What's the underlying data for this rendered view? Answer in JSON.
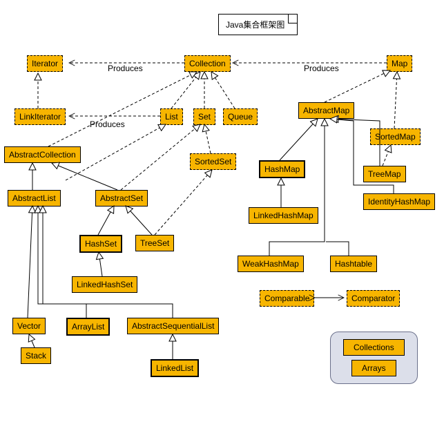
{
  "title": "Java集合框架图",
  "legend": {
    "items": [
      "Collections",
      "Arrays"
    ]
  },
  "edge_labels": {
    "p1": "Produces",
    "p2": "Produces",
    "p3": "Produces"
  },
  "nodes": {
    "iterator": "Iterator",
    "collection": "Collection",
    "map": "Map",
    "linkIterator": "LinkIterator",
    "list": "List",
    "set": "Set",
    "queue": "Queue",
    "abstractMap": "AbstractMap",
    "sortedMap": "SortedMap",
    "abstractCollection": "AbstractCollection",
    "sortedSet": "SortedSet",
    "hashMap": "HashMap",
    "treeMap": "TreeMap",
    "identityHashMap": "IdentityHashMap",
    "abstractList": "AbstractList",
    "abstractSet": "AbstractSet",
    "linkedHashMap": "LinkedHashMap",
    "hashSet": "HashSet",
    "treeSet": "TreeSet",
    "weakHashMap": "WeakHashMap",
    "hashtable": "Hashtable",
    "linkedHashSet": "LinkedHashSet",
    "comparable": "Comparable",
    "comparator": "Comparator",
    "vector": "Vector",
    "arrayList": "ArrayList",
    "abstractSequentialList": "AbstractSequentialList",
    "stack": "Stack",
    "linkedList": "LinkedList"
  },
  "chart_data": {
    "type": "diagram",
    "title": "Java集合框架图",
    "notation": "UML class diagram (interfaces shown with dashed borders, classes with solid borders, highlighted concrete classes with bold borders)",
    "interfaces": [
      "Iterator",
      "LinkIterator",
      "Collection",
      "List",
      "Set",
      "Queue",
      "SortedSet",
      "Map",
      "SortedMap",
      "Comparable",
      "Comparator"
    ],
    "abstract_classes": [
      "AbstractCollection",
      "AbstractList",
      "AbstractSet",
      "AbstractSequentialList",
      "AbstractMap"
    ],
    "concrete_classes": [
      "HashSet",
      "LinkedHashSet",
      "TreeSet",
      "Vector",
      "Stack",
      "ArrayList",
      "LinkedList",
      "HashMap",
      "LinkedHashMap",
      "TreeMap",
      "IdentityHashMap",
      "WeakHashMap",
      "Hashtable"
    ],
    "highlighted_classes": [
      "HashSet",
      "ArrayList",
      "LinkedList",
      "HashMap"
    ],
    "utility_classes": [
      "Collections",
      "Arrays"
    ],
    "edges": [
      {
        "from": "LinkIterator",
        "to": "Iterator",
        "type": "extends",
        "style": "dashed",
        "head": "hollow-triangle"
      },
      {
        "from": "List",
        "to": "Collection",
        "type": "extends",
        "style": "dashed",
        "head": "hollow-triangle"
      },
      {
        "from": "Set",
        "to": "Collection",
        "type": "extends",
        "style": "dashed",
        "head": "hollow-triangle"
      },
      {
        "from": "Queue",
        "to": "Collection",
        "type": "extends",
        "style": "dashed",
        "head": "hollow-triangle"
      },
      {
        "from": "SortedSet",
        "to": "Set",
        "type": "extends",
        "style": "dashed",
        "head": "hollow-triangle"
      },
      {
        "from": "SortedMap",
        "to": "Map",
        "type": "extends",
        "style": "dashed",
        "head": "hollow-triangle"
      },
      {
        "from": "AbstractCollection",
        "to": "Collection",
        "type": "implements",
        "style": "dashed",
        "head": "hollow-triangle"
      },
      {
        "from": "AbstractList",
        "to": "AbstractCollection",
        "type": "extends",
        "style": "solid",
        "head": "hollow-triangle"
      },
      {
        "from": "AbstractList",
        "to": "List",
        "type": "implements",
        "style": "dashed",
        "head": "hollow-triangle"
      },
      {
        "from": "AbstractSet",
        "to": "AbstractCollection",
        "type": "extends",
        "style": "solid",
        "head": "hollow-triangle"
      },
      {
        "from": "AbstractSet",
        "to": "Set",
        "type": "implements",
        "style": "dashed",
        "head": "hollow-triangle"
      },
      {
        "from": "TreeSet",
        "to": "SortedSet",
        "type": "implements",
        "style": "dashed",
        "head": "hollow-triangle"
      },
      {
        "from": "HashSet",
        "to": "AbstractSet",
        "type": "extends",
        "style": "solid",
        "head": "hollow-triangle"
      },
      {
        "from": "TreeSet",
        "to": "AbstractSet",
        "type": "extends",
        "style": "solid",
        "head": "hollow-triangle"
      },
      {
        "from": "LinkedHashSet",
        "to": "HashSet",
        "type": "extends",
        "style": "solid",
        "head": "hollow-triangle"
      },
      {
        "from": "Vector",
        "to": "AbstractList",
        "type": "extends",
        "style": "solid",
        "head": "hollow-triangle"
      },
      {
        "from": "ArrayList",
        "to": "AbstractList",
        "type": "extends",
        "style": "solid",
        "head": "hollow-triangle"
      },
      {
        "from": "AbstractSequentialList",
        "to": "AbstractList",
        "type": "extends",
        "style": "solid",
        "head": "hollow-triangle"
      },
      {
        "from": "Stack",
        "to": "Vector",
        "type": "extends",
        "style": "solid",
        "head": "hollow-triangle"
      },
      {
        "from": "LinkedList",
        "to": "AbstractSequentialList",
        "type": "extends",
        "style": "solid",
        "head": "hollow-triangle"
      },
      {
        "from": "AbstractMap",
        "to": "Map",
        "type": "implements",
        "style": "dashed",
        "head": "hollow-triangle"
      },
      {
        "from": "HashMap",
        "to": "AbstractMap",
        "type": "extends",
        "style": "solid",
        "head": "hollow-triangle"
      },
      {
        "from": "TreeMap",
        "to": "AbstractMap",
        "type": "extends",
        "style": "solid",
        "head": "hollow-triangle"
      },
      {
        "from": "TreeMap",
        "to": "SortedMap",
        "type": "implements",
        "style": "dashed",
        "head": "hollow-triangle"
      },
      {
        "from": "IdentityHashMap",
        "to": "AbstractMap",
        "type": "extends",
        "style": "solid",
        "head": "hollow-triangle"
      },
      {
        "from": "WeakHashMap",
        "to": "AbstractMap",
        "type": "extends",
        "style": "solid",
        "head": "hollow-triangle"
      },
      {
        "from": "Hashtable",
        "to": "AbstractMap",
        "type": "extends",
        "style": "solid",
        "head": "hollow-triangle"
      },
      {
        "from": "LinkedHashMap",
        "to": "HashMap",
        "type": "extends",
        "style": "solid",
        "head": "hollow-triangle"
      },
      {
        "from": "Collection",
        "to": "Iterator",
        "type": "produces",
        "style": "dashed",
        "head": "open-arrow",
        "label": "Produces"
      },
      {
        "from": "Map",
        "to": "Collection",
        "type": "produces",
        "style": "dashed",
        "head": "open-arrow",
        "label": "Produces"
      },
      {
        "from": "List",
        "to": "LinkIterator",
        "type": "produces",
        "style": "dashed",
        "head": "open-arrow",
        "label": "Produces"
      },
      {
        "from": "Comparable",
        "to": "Comparator",
        "type": "association",
        "style": "solid",
        "head": "open-arrow-both"
      }
    ]
  }
}
